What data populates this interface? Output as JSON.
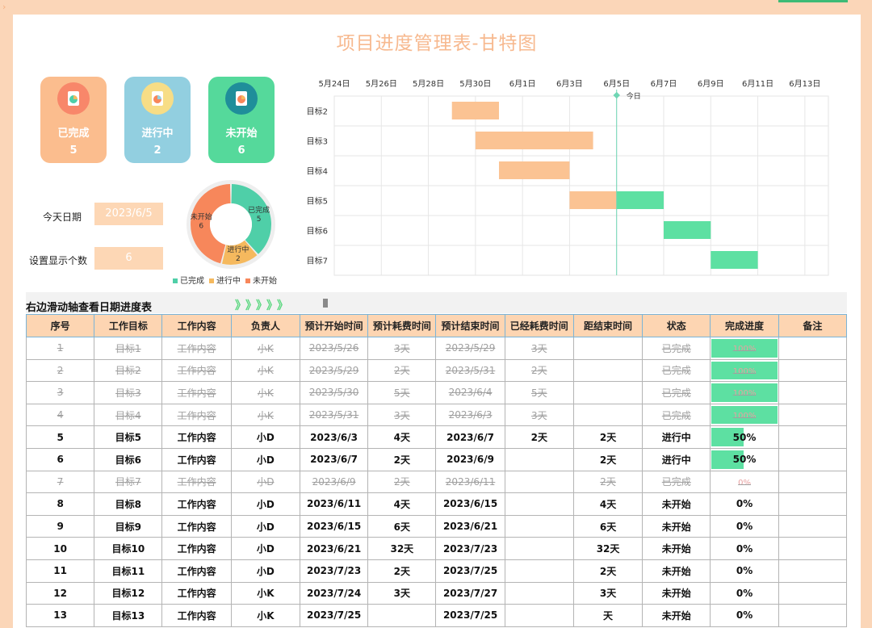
{
  "title": "项目进度管理表-甘特图",
  "cards": [
    {
      "label": "已完成",
      "count": "5",
      "color": "#fbbd8e",
      "icon": "pie-chart-doc-icon"
    },
    {
      "label": "进行中",
      "count": "2",
      "color": "#92cfe0",
      "icon": "pie-chart-doc-icon"
    },
    {
      "label": "未开始",
      "count": "6",
      "color": "#55d99b",
      "icon": "pie-chart-doc-icon"
    }
  ],
  "today": {
    "label": "今天日期",
    "value": "2023/6/5"
  },
  "display_count": {
    "label": "设置显示个数",
    "value": "6"
  },
  "colors": {
    "done": "#4fcfa8",
    "in_progress": "#f5b95e",
    "not_started": "#f7875b",
    "gantt_orange": "#fbc393",
    "gantt_green": "#5de0a2",
    "today_line": "#6fd6b4"
  },
  "donut_legend": [
    "已完成",
    "进行中",
    "未开始"
  ],
  "chart_data": [
    {
      "type": "pie",
      "labels": [
        "已完成",
        "进行中",
        "未开始"
      ],
      "values": [
        5,
        2,
        6
      ],
      "legend": "bottom"
    },
    {
      "type": "gantt",
      "x_ticks": [
        "5月24日",
        "5月26日",
        "5月28日",
        "5月30日",
        "6月1日",
        "6月3日",
        "6月5日",
        "6月7日",
        "6月9日",
        "6月11日",
        "6月13日"
      ],
      "x_start": "2023-05-24",
      "today": "2023-06-05",
      "today_label": "今日",
      "categories": [
        "目标2",
        "目标3",
        "目标4",
        "目标5",
        "目标6",
        "目标7"
      ],
      "segments": [
        {
          "task": "目标2",
          "start": "2023-05-29",
          "end": "2023-05-31",
          "color": "orange"
        },
        {
          "task": "目标3",
          "start": "2023-05-30",
          "end": "2023-06-04",
          "color": "orange"
        },
        {
          "task": "目标4",
          "start": "2023-05-31",
          "end": "2023-06-03",
          "color": "orange"
        },
        {
          "task": "目标5",
          "start": "2023-06-03",
          "end": "2023-06-05",
          "color": "orange"
        },
        {
          "task": "目标5",
          "start": "2023-06-05",
          "end": "2023-06-07",
          "color": "green"
        },
        {
          "task": "目标6",
          "start": "2023-06-07",
          "end": "2023-06-09",
          "color": "green"
        },
        {
          "task": "目标7",
          "start": "2023-06-09",
          "end": "2023-06-11",
          "color": "green"
        }
      ]
    }
  ],
  "scroll_caption": "右边滑动轴查看日期进度表",
  "scroll_arrows": "》》》》》",
  "table": {
    "headers": [
      "序号",
      "工作目标",
      "工作内容",
      "负责人",
      "预计开始时间",
      "预计耗费时间",
      "预计结束时间",
      "已经耗费时间",
      "距结束时间",
      "状态",
      "完成进度",
      "备注"
    ],
    "rows": [
      {
        "done": true,
        "progress": 1.0,
        "cells": [
          "1",
          "目标1",
          "工作内容",
          "小K",
          "2023/5/26",
          "3天",
          "2023/5/29",
          "3天",
          "",
          "已完成",
          "100%",
          ""
        ]
      },
      {
        "done": true,
        "progress": 1.0,
        "cells": [
          "2",
          "目标2",
          "工作内容",
          "小K",
          "2023/5/29",
          "2天",
          "2023/5/31",
          "2天",
          "",
          "已完成",
          "100%",
          ""
        ]
      },
      {
        "done": true,
        "progress": 1.0,
        "cells": [
          "3",
          "目标3",
          "工作内容",
          "小K",
          "2023/5/30",
          "5天",
          "2023/6/4",
          "5天",
          "",
          "已完成",
          "100%",
          ""
        ]
      },
      {
        "done": true,
        "progress": 1.0,
        "cells": [
          "4",
          "目标4",
          "工作内容",
          "小K",
          "2023/5/31",
          "3天",
          "2023/6/3",
          "3天",
          "",
          "已完成",
          "100%",
          ""
        ]
      },
      {
        "done": false,
        "progress": 0.5,
        "cells": [
          "5",
          "目标5",
          "工作内容",
          "小D",
          "2023/6/3",
          "4天",
          "2023/6/7",
          "2天",
          "2天",
          "进行中",
          "50%",
          ""
        ]
      },
      {
        "done": false,
        "progress": 0.5,
        "cells": [
          "6",
          "目标6",
          "工作内容",
          "小D",
          "2023/6/7",
          "2天",
          "2023/6/9",
          "",
          "2天",
          "进行中",
          "50%",
          ""
        ]
      },
      {
        "done": true,
        "progress": 0,
        "cells": [
          "7",
          "目标7",
          "工作内容",
          "小D",
          "2023/6/9",
          "2天",
          "2023/6/11",
          "",
          "2天",
          "已完成",
          "0%",
          ""
        ]
      },
      {
        "done": false,
        "progress": 0,
        "cells": [
          "8",
          "目标8",
          "工作内容",
          "小D",
          "2023/6/11",
          "4天",
          "2023/6/15",
          "",
          "4天",
          "未开始",
          "0%",
          ""
        ]
      },
      {
        "done": false,
        "progress": 0,
        "cells": [
          "9",
          "目标9",
          "工作内容",
          "小D",
          "2023/6/15",
          "6天",
          "2023/6/21",
          "",
          "6天",
          "未开始",
          "0%",
          ""
        ]
      },
      {
        "done": false,
        "progress": 0,
        "cells": [
          "10",
          "目标10",
          "工作内容",
          "小D",
          "2023/6/21",
          "32天",
          "2023/7/23",
          "",
          "32天",
          "未开始",
          "0%",
          ""
        ]
      },
      {
        "done": false,
        "progress": 0,
        "cells": [
          "11",
          "目标11",
          "工作内容",
          "小D",
          "2023/7/23",
          "2天",
          "2023/7/25",
          "",
          "2天",
          "未开始",
          "0%",
          ""
        ]
      },
      {
        "done": false,
        "progress": 0,
        "cells": [
          "12",
          "目标12",
          "工作内容",
          "小K",
          "2023/7/24",
          "3天",
          "2023/7/27",
          "",
          "3天",
          "未开始",
          "0%",
          ""
        ]
      },
      {
        "done": false,
        "progress": 0,
        "cells": [
          "13",
          "目标13",
          "工作内容",
          "小K",
          "2023/7/25",
          "",
          "2023/7/25",
          "",
          "天",
          "未开始",
          "0%",
          ""
        ]
      }
    ]
  }
}
